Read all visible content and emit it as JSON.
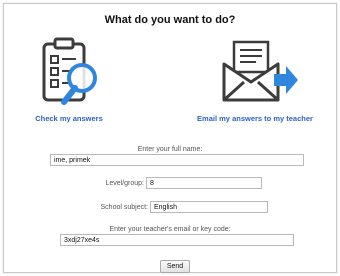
{
  "header": {
    "title": "What do you want to do?"
  },
  "actions": {
    "check": {
      "label": "Check my answers",
      "icon": "clipboard-magnifier-icon"
    },
    "email": {
      "label": "Email my answers to my teacher",
      "icon": "envelope-send-icon"
    }
  },
  "form": {
    "full_name": {
      "label": "Enter your full name:",
      "value": "ime, primek"
    },
    "level": {
      "label": "Level/group:",
      "value": "8"
    },
    "subject": {
      "label": "School subject:",
      "value": "English"
    },
    "teacher": {
      "label": "Enter your teacher's email or key code:",
      "value": "3xdj27xe4s"
    },
    "send_label": "Send"
  },
  "colors": {
    "link": "#2a63c9",
    "icon_blue": "#2e86de",
    "icon_dark": "#3c3c3c"
  }
}
